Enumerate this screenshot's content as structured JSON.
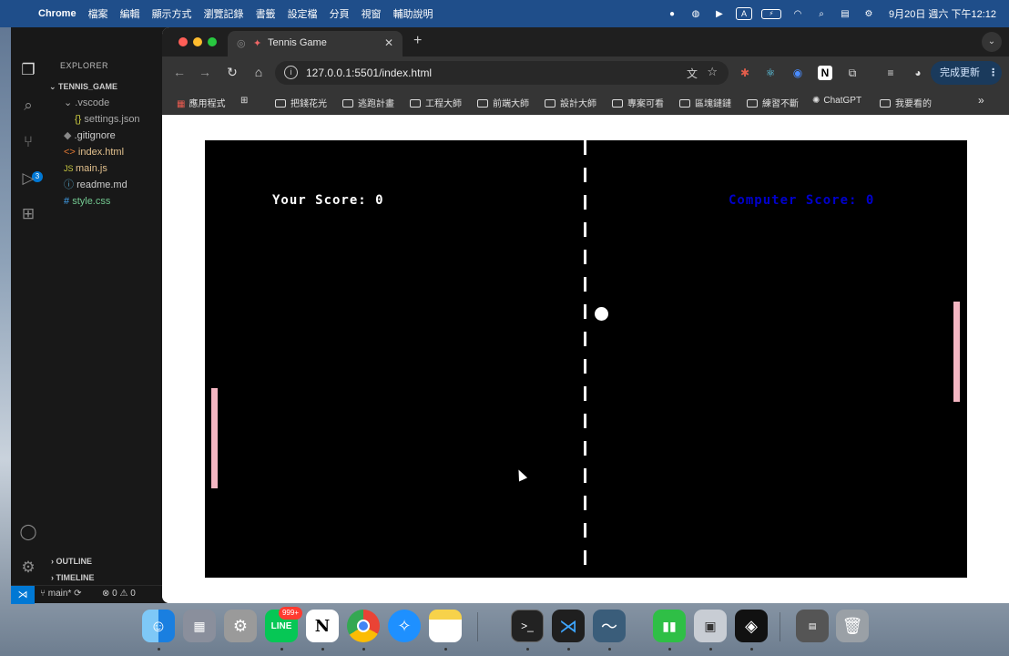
{
  "menubar": {
    "app": "Chrome",
    "menus": [
      "檔案",
      "編輯",
      "顯示方式",
      "瀏覽記錄",
      "書籤",
      "設定檔",
      "分頁",
      "視窗",
      "輔助說明"
    ],
    "input_label": "A",
    "clock": "9月20日 週六 下午12:12"
  },
  "vscode": {
    "explorer_title": "EXPLORER",
    "project": "TENNIS_GAME",
    "files": [
      {
        "name": ".vscode",
        "status": ""
      },
      {
        "name": "settings.json",
        "status": ""
      },
      {
        "name": ".gitignore",
        "status": ""
      },
      {
        "name": "index.html",
        "status": "M"
      },
      {
        "name": "main.js",
        "status": "M"
      },
      {
        "name": "readme.md",
        "status": ""
      },
      {
        "name": "style.css",
        "status": "U"
      }
    ],
    "outline": "OUTLINE",
    "timeline": "TIMELINE",
    "scm_badge": "3",
    "branch": "main*",
    "problems": "⊗ 0 ⚠ 0"
  },
  "chrome": {
    "tab_title": "Tennis Game",
    "url": "127.0.0.1:5501/index.html",
    "update_label": "完成更新",
    "bookmarks": [
      "應用程式",
      "把錢花光",
      "逃跑計畫",
      "工程大師",
      "前端大師",
      "設計大師",
      "專案可看",
      "區塊鏈鏈",
      "練習不斷",
      "ChatGPT",
      "我要看的"
    ]
  },
  "game": {
    "player_score_label": "Your Score: 0",
    "computer_score_label": "Computer Score: 0"
  },
  "dock": {
    "line_badge": "999+"
  },
  "colors": {
    "paddle": "#f4b6c2",
    "computer_score": "#0000cc",
    "court": "#000000"
  }
}
